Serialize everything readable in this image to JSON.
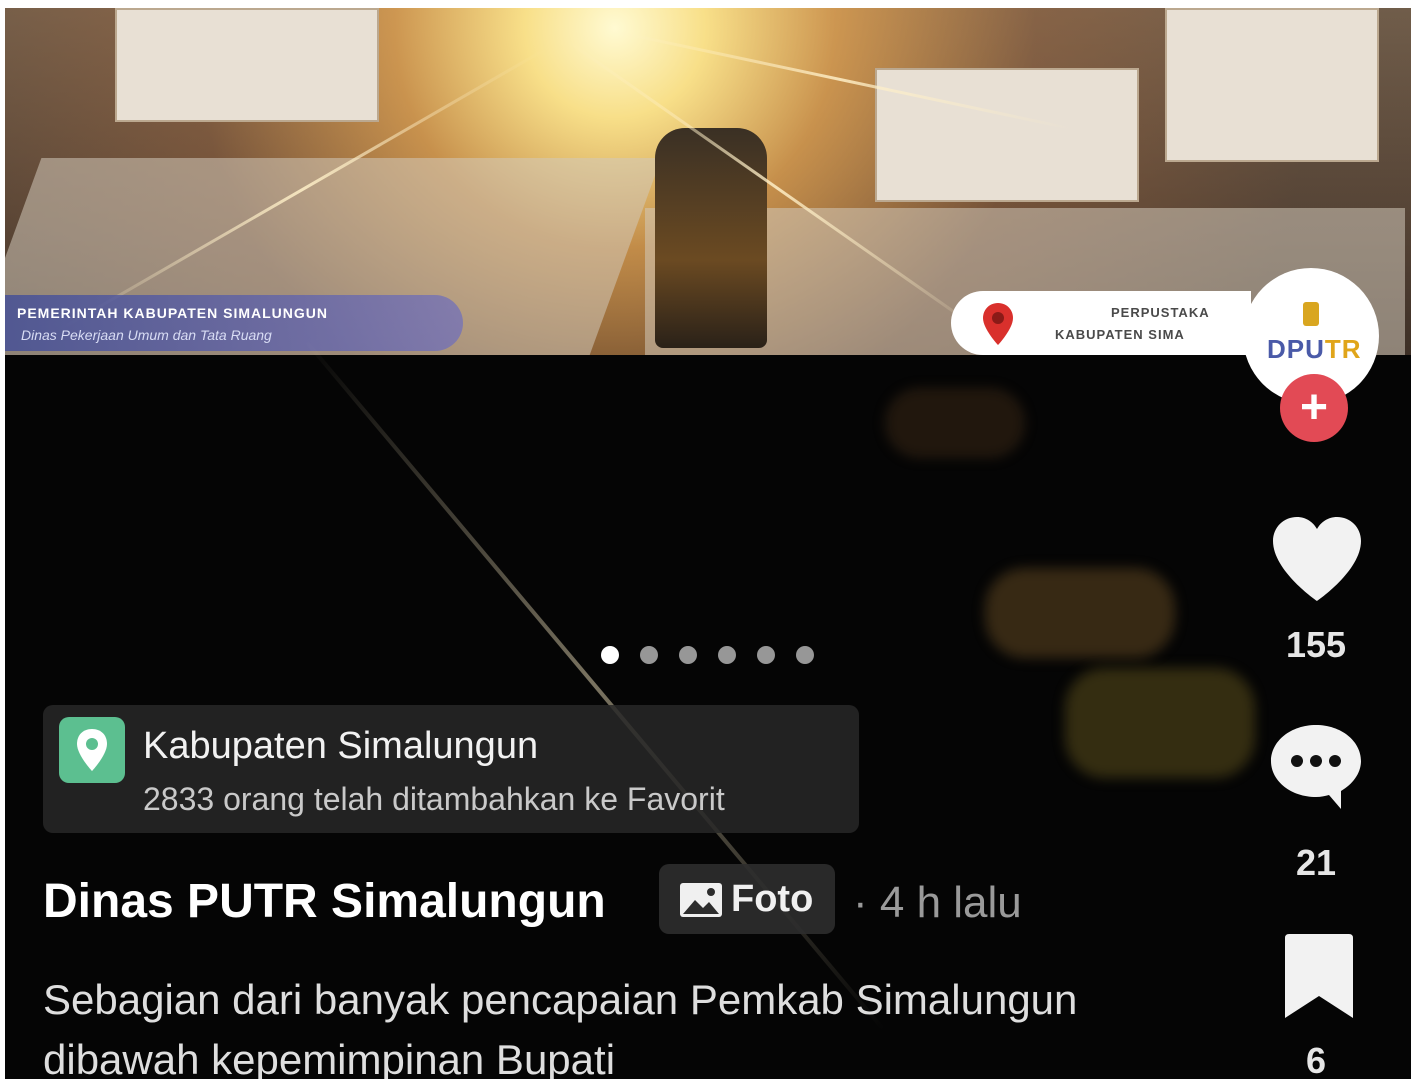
{
  "photo": {
    "gov_label_title": "PEMERINTAH KABUPATEN SIMALUNGUN",
    "gov_label_subtitle": "Dinas Pekerjaan Umum dan Tata Ruang",
    "location_line1": "PERPUSTAKA",
    "location_line2": "KABUPATEN SIMA"
  },
  "rail": {
    "avatar_logo_main": "DPU",
    "avatar_logo_accent": "TR",
    "follow_label": "+",
    "likes": "155",
    "comments": "21",
    "saves": "6",
    "icons": [
      "heart-icon",
      "comment-icon",
      "bookmark-icon",
      "plus-icon"
    ],
    "like_color": "#f2f2f2",
    "follow_color": "#e24a55"
  },
  "carousel": {
    "total": 6,
    "active_index": 0
  },
  "location_card": {
    "name": "Kabupaten Simalungun",
    "favorites": "2833 orang telah ditambahkan ke Favorit",
    "icon": "location-pin-icon",
    "icon_color": "#5cbf90"
  },
  "post": {
    "author": "Dinas PUTR Simalungun",
    "type_label": "Foto",
    "type_icon": "photo-icon",
    "timestamp": "· 4 h lalu",
    "caption": "Sebagian dari banyak pencapaian Pemkab Simalungun dibawah kepemimpinan Bupati"
  }
}
